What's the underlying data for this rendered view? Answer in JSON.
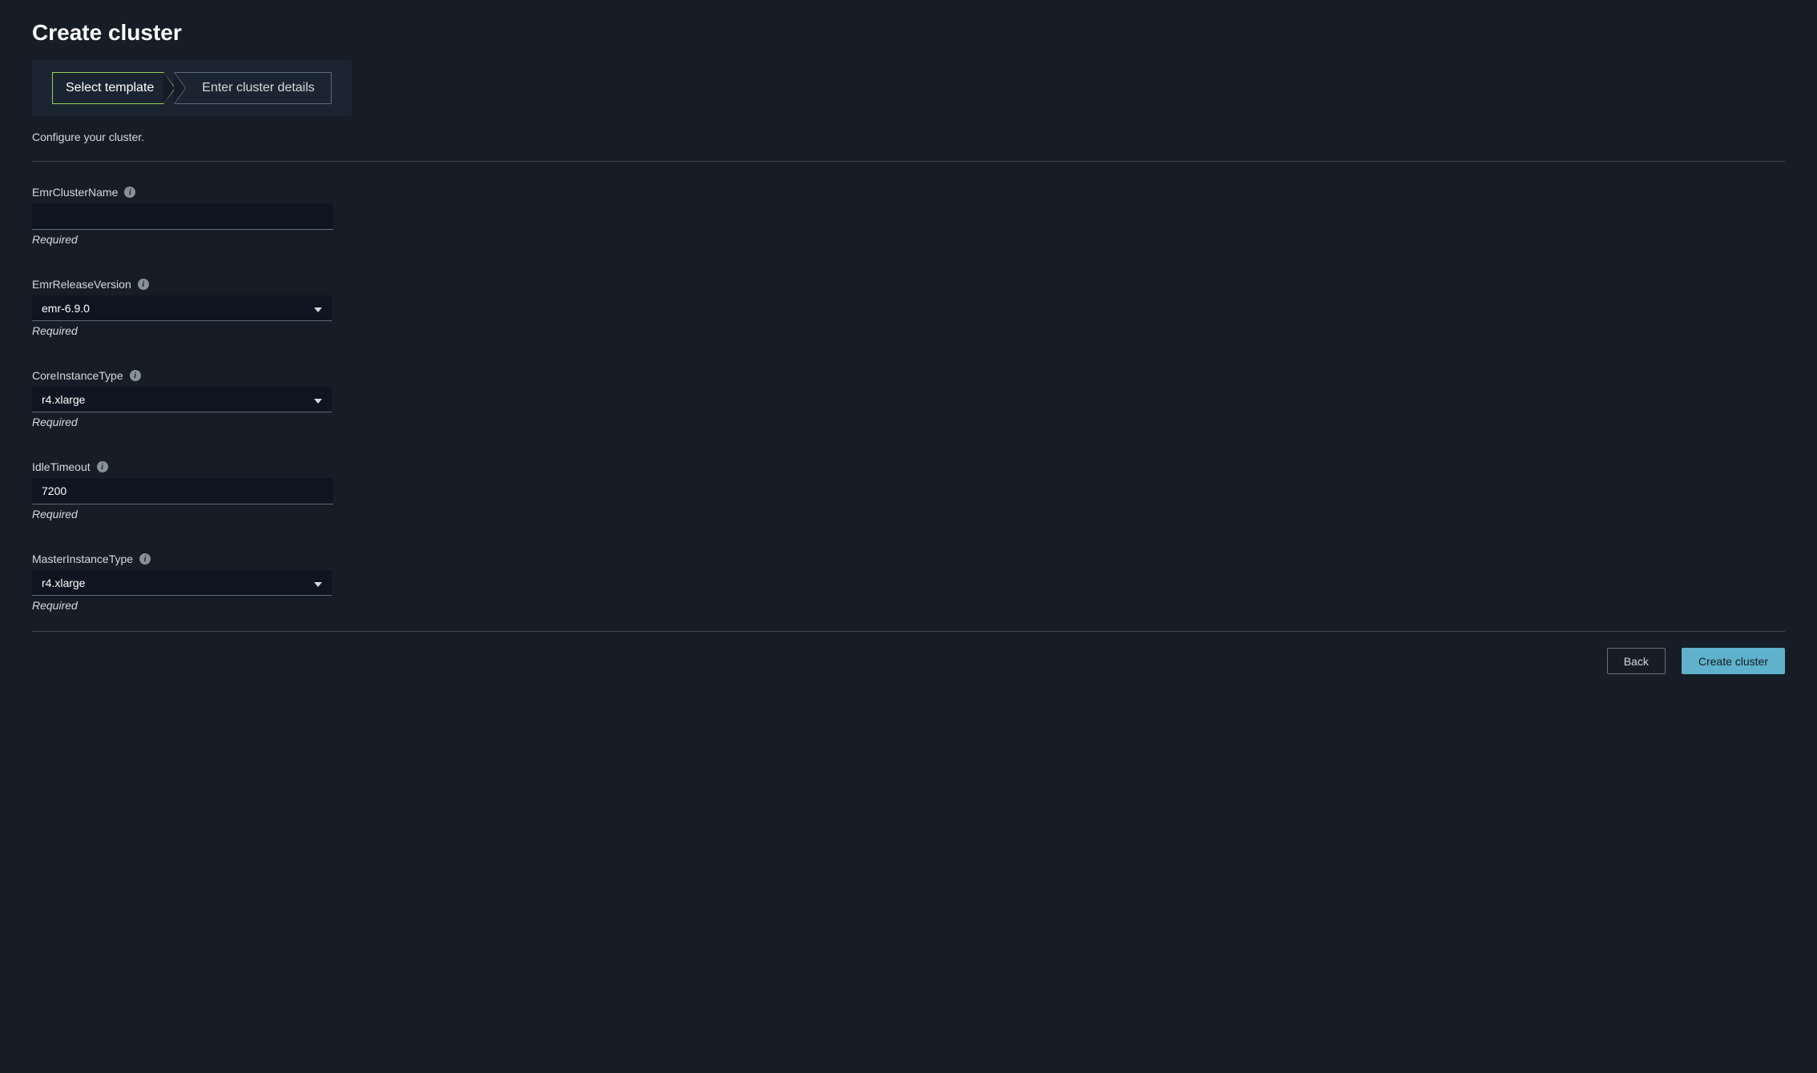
{
  "header": {
    "title": "Create cluster"
  },
  "stepper": {
    "step1": "Select template",
    "step2": "Enter cluster details"
  },
  "description": "Configure your cluster.",
  "fields": {
    "clusterName": {
      "label": "EmrClusterName",
      "value": "",
      "hint": "Required"
    },
    "releaseVersion": {
      "label": "EmrReleaseVersion",
      "value": "emr-6.9.0",
      "hint": "Required"
    },
    "coreInstanceType": {
      "label": "CoreInstanceType",
      "value": "r4.xlarge",
      "hint": "Required"
    },
    "idleTimeout": {
      "label": "IdleTimeout",
      "value": "7200",
      "hint": "Required"
    },
    "masterInstanceType": {
      "label": "MasterInstanceType",
      "value": "r4.xlarge",
      "hint": "Required"
    }
  },
  "actions": {
    "back": "Back",
    "create": "Create cluster"
  }
}
